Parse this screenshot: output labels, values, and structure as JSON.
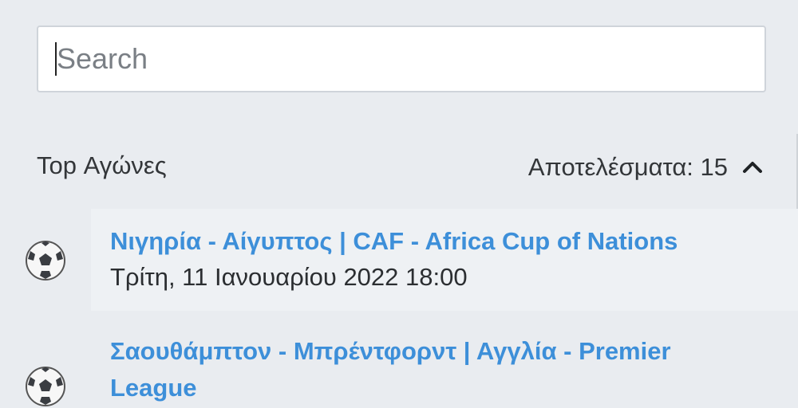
{
  "search": {
    "placeholder": "Search"
  },
  "section": {
    "title": "Top Αγώνες",
    "results_label": "Αποτελέσματα: 15"
  },
  "matches": [
    {
      "title": "Νιγηρία - Αίγυπτος | CAF - Africa Cup of Nations",
      "date": "Τρίτη, 11 Ιανουαρίου 2022 18:00",
      "icon": "soccer-ball-icon"
    },
    {
      "title": "Σαουθάμπτον - Μπρέντφορντ | Αγγλία - Premier League",
      "date": "",
      "icon": "soccer-ball-icon"
    }
  ],
  "colors": {
    "background": "#e9ecf0",
    "link": "#3d8fd9",
    "text": "#333639"
  }
}
